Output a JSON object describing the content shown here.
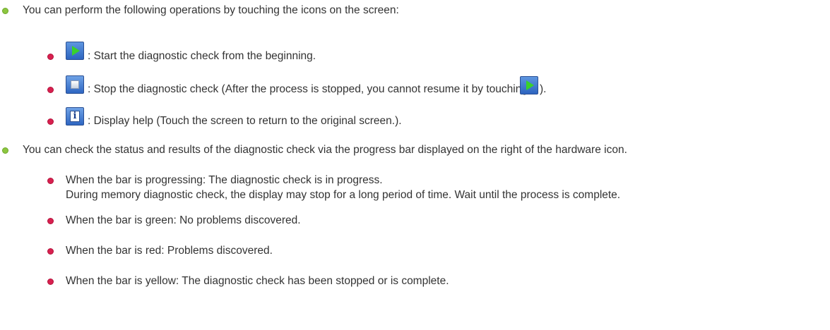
{
  "items": [
    {
      "text": "You can perform the following operations by touching the icons on the screen:"
    },
    {
      "icon": "play-icon",
      "text": ": Start the diagnostic check from the beginning."
    },
    {
      "icon": "stop-icon",
      "text": ": Stop the diagnostic check (After the process is stopped, you cannot resume it by touching",
      "text_after": ")."
    },
    {
      "icon": "info-icon",
      "text": ": Display help (Touch the screen to return to the original screen.)."
    },
    {
      "text": "You can check the status and results of the diagnostic check via the progress bar displayed on the right of the hardware icon."
    },
    {
      "text": "When the bar is progressing: The diagnostic check is in progress."
    },
    {
      "text": "During memory diagnostic check, the display may stop for a long period of time. Wait until the process is complete."
    },
    {
      "text": "When the bar is green: No problems discovered."
    },
    {
      "text": "When the bar is red: Problems discovered."
    },
    {
      "text": "When the bar is yellow: The diagnostic check has been stopped or is complete."
    }
  ],
  "info_glyph": "i",
  "colors": {
    "text": "#333333",
    "green_bullet": "#8cc63f",
    "red_bullet": "#d8204f",
    "icon_blue": "#2d64bf",
    "play_green": "#39d12a"
  }
}
